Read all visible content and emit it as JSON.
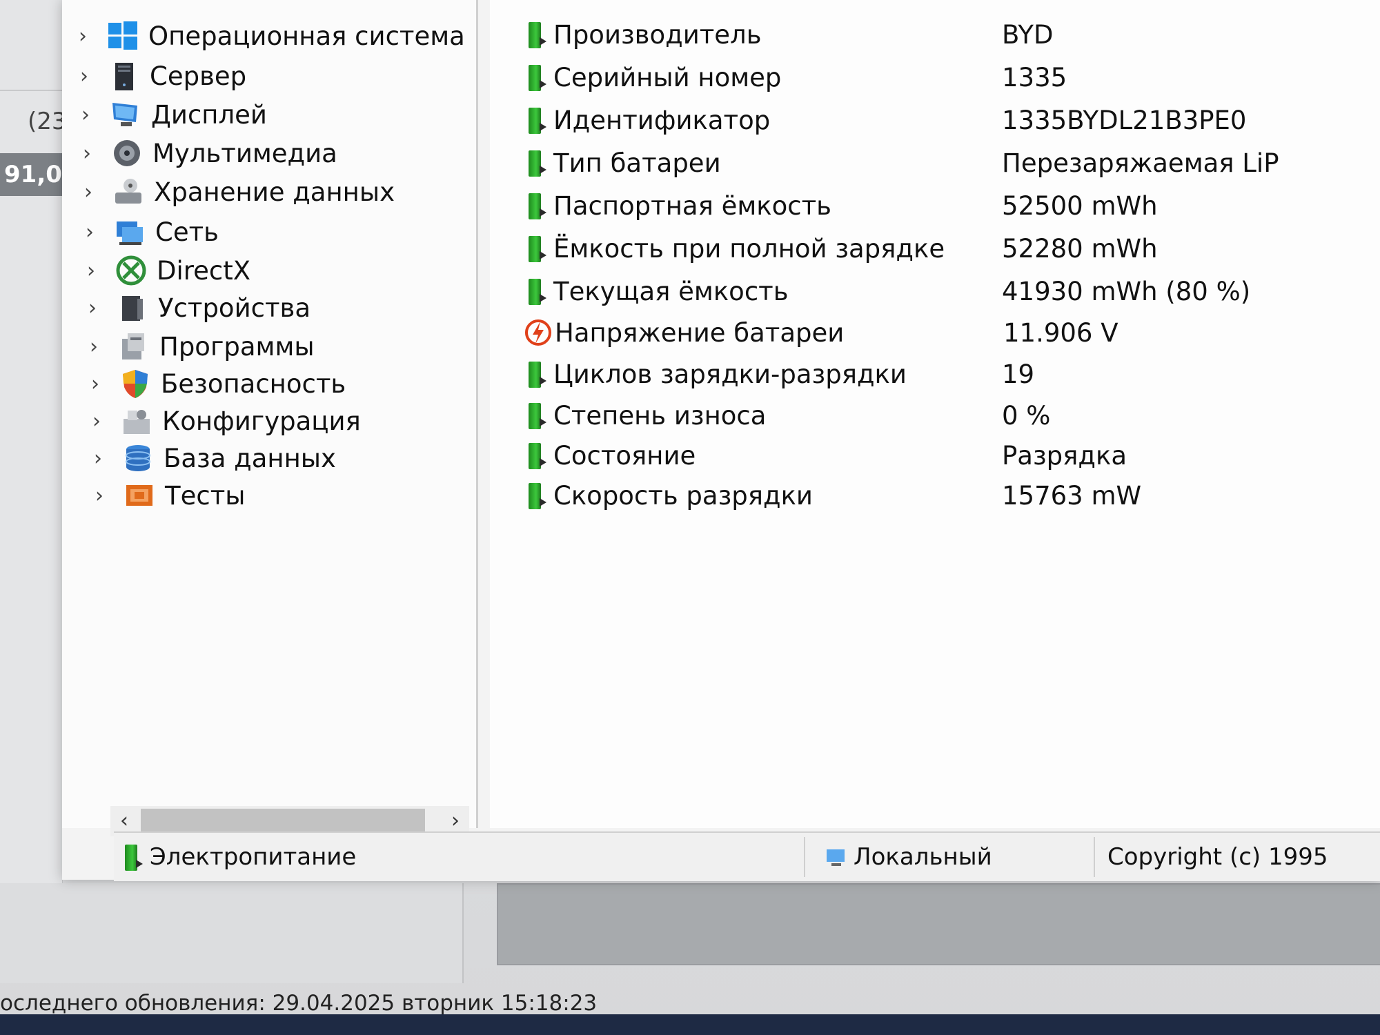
{
  "background": {
    "readout_1": "(23",
    "readout_2": "91,0",
    "last_update": "оследнего обновления: 29.04.2025 вторник 15:18:23"
  },
  "tree": {
    "items": [
      {
        "label": "Операционная система",
        "icon": "windows-icon"
      },
      {
        "label": "Сервер",
        "icon": "server-icon"
      },
      {
        "label": "Дисплей",
        "icon": "display-icon"
      },
      {
        "label": "Мультимедиа",
        "icon": "multimedia-icon"
      },
      {
        "label": "Хранение данных",
        "icon": "storage-icon"
      },
      {
        "label": "Сеть",
        "icon": "network-icon"
      },
      {
        "label": "DirectX",
        "icon": "directx-icon"
      },
      {
        "label": "Устройства",
        "icon": "devices-icon"
      },
      {
        "label": "Программы",
        "icon": "programs-icon"
      },
      {
        "label": "Безопасность",
        "icon": "security-shield-icon"
      },
      {
        "label": "Конфигурация",
        "icon": "configuration-icon"
      },
      {
        "label": "База данных",
        "icon": "database-icon"
      },
      {
        "label": "Тесты",
        "icon": "tests-icon"
      }
    ]
  },
  "battery": {
    "rows": [
      {
        "label": "Производитель",
        "value": "BYD"
      },
      {
        "label": "Серийный номер",
        "value": "1335"
      },
      {
        "label": "Идентификатор",
        "value": "1335BYDL21B3PE0"
      },
      {
        "label": "Тип батареи",
        "value": "Перезаряжаемая LiP"
      },
      {
        "label": "Паспортная ёмкость",
        "value": "52500 mWh"
      },
      {
        "label": "Ёмкость при полной зарядке",
        "value": "52280 mWh"
      },
      {
        "label": "Текущая ёмкость",
        "value": "41930 mWh  (80 %)"
      },
      {
        "label": "Напряжение батареи",
        "value": "11.906 V"
      },
      {
        "label": "Циклов зарядки-разрядки",
        "value": "19"
      },
      {
        "label": "Степень износа",
        "value": "0 %"
      },
      {
        "label": "Состояние",
        "value": "Разрядка"
      },
      {
        "label": "Скорость разрядки",
        "value": "15763 mW"
      }
    ]
  },
  "status_bar": {
    "section": "Электропитание",
    "mode": "Локальный",
    "copyright": "Copyright (c) 1995"
  },
  "colors": {
    "battery_green": "#3cc83c",
    "voltage_red": "#e0401a"
  }
}
